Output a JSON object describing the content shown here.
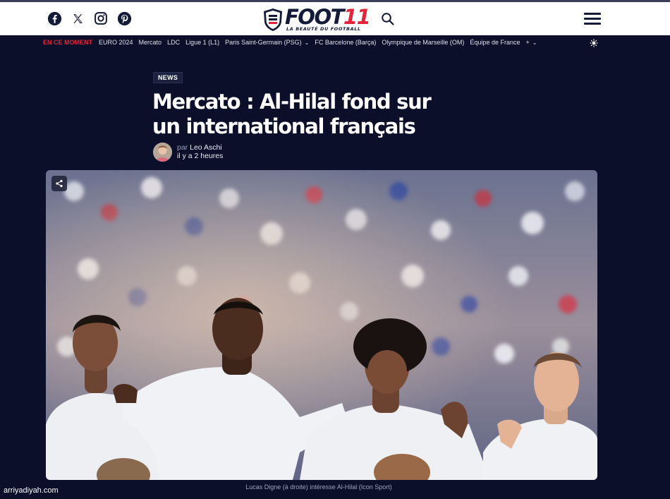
{
  "header": {
    "social": [
      {
        "icon": "facebook-icon"
      },
      {
        "icon": "x-twitter-icon"
      },
      {
        "icon": "instagram-icon"
      },
      {
        "icon": "pinterest-icon"
      }
    ],
    "logo": {
      "main": "FOOT",
      "number": "11",
      "tagline": "LA BEAUTÉ DU FOOTBALL"
    },
    "search_icon": "search-icon",
    "menu_icon": "hamburger-menu-icon"
  },
  "nav": {
    "now_label": "EN CE MOMENT",
    "items": [
      {
        "label": "EURO 2024"
      },
      {
        "label": "Mercato"
      },
      {
        "label": "LDC"
      },
      {
        "label": "Ligue 1 (L1)"
      },
      {
        "label": "Paris Saint-Germain (PSG)",
        "dropdown": true
      },
      {
        "label": "FC Barcelone (Barça)"
      },
      {
        "label": "Olympique de Marseille (OM)"
      },
      {
        "label": "Équipe de France"
      }
    ],
    "more_label": "+"
  },
  "article": {
    "category": "NEWS",
    "title": "Mercato : Al-Hilal fond sur un international français",
    "by_label": "par",
    "author": "Leo Aschi",
    "time": "il y a 2 heures",
    "caption": "Lucas Digne (à droite) intéresse Al-Hilal (Icon Sport)"
  },
  "watermark": "arriyadiyah.com",
  "colors": {
    "accent": "#e4223a",
    "background": "#0b0f2a",
    "logo_dark": "#141a3a"
  }
}
